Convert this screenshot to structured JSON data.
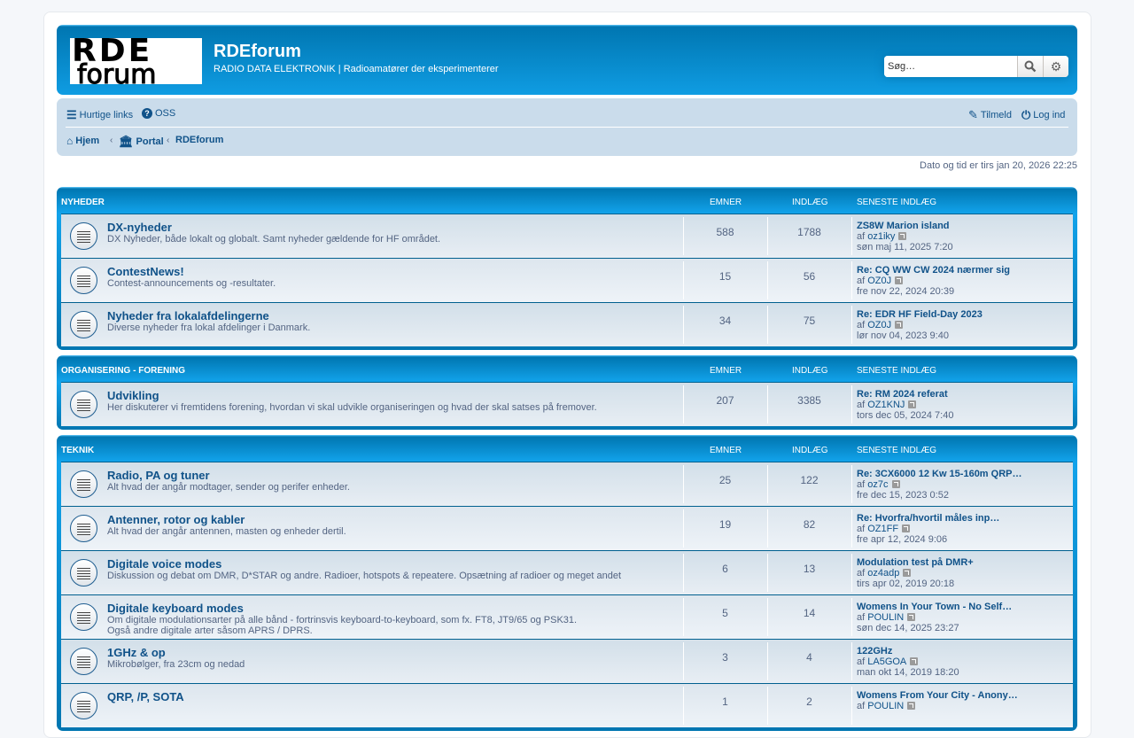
{
  "header": {
    "logo_text": "RDE forum",
    "site_title": "RDEforum",
    "site_description": "RADIO DATA ELEKTRONIK | Radioamatører der eksperimenterer",
    "search_placeholder": "Søg…"
  },
  "navbar": {
    "quick_links": "Hurtige links",
    "faq": "OSS",
    "register": "Tilmeld",
    "login": "Log ind",
    "breadcrumbs": [
      "Hjem",
      "Portal",
      "RDEforum"
    ]
  },
  "datetime": "Dato og tid er tirs jan 20, 2026 22:25",
  "columns": {
    "topics": "EMNER",
    "posts": "INDLÆG",
    "last_post": "SENESTE INDLÆG"
  },
  "by_prefix": "af",
  "categories": [
    {
      "name": "NYHEDER",
      "forums": [
        {
          "title": "DX-nyheder",
          "desc": [
            "DX Nyheder, både lokalt og globalt. Samt nyheder gældende for HF området."
          ],
          "topics": "588",
          "posts": "1788",
          "last_title": "ZS8W Marion island",
          "last_user": "oz1iky",
          "last_time": "søn maj 11, 2025 7:20"
        },
        {
          "title": "ContestNews!",
          "desc": [
            "Contest-announcements og -resultater."
          ],
          "topics": "15",
          "posts": "56",
          "last_title": "Re: CQ WW CW 2024 nærmer sig",
          "last_user": "OZ0J",
          "last_time": "fre nov 22, 2024 20:39"
        },
        {
          "title": "Nyheder fra lokalafdelingerne",
          "desc": [
            "Diverse nyheder fra lokal afdelinger i Danmark."
          ],
          "topics": "34",
          "posts": "75",
          "last_title": "Re: EDR HF Field-Day 2023",
          "last_user": "OZ0J",
          "last_time": "lør nov 04, 2023 9:40"
        }
      ]
    },
    {
      "name": "ORGANISERING - FORENING",
      "forums": [
        {
          "title": "Udvikling",
          "desc": [
            "Her diskuterer vi fremtidens forening, hvordan vi skal udvikle organiseringen og hvad der skal satses på fremover."
          ],
          "topics": "207",
          "posts": "3385",
          "last_title": "Re: RM 2024 referat",
          "last_user": "OZ1KNJ",
          "last_time": "tors dec 05, 2024 7:40"
        }
      ]
    },
    {
      "name": "TEKNIK",
      "forums": [
        {
          "title": "Radio, PA og tuner",
          "desc": [
            "Alt hvad der angår modtager, sender og perifer enheder."
          ],
          "topics": "25",
          "posts": "122",
          "last_title": "Re: 3CX6000 12 Kw 15-160m QRP…",
          "last_user": "oz7c",
          "last_time": "fre dec 15, 2023 0:52"
        },
        {
          "title": "Antenner, rotor og kabler",
          "desc": [
            "Alt hvad der angår antennen, masten og enheder dertil."
          ],
          "topics": "19",
          "posts": "82",
          "last_title": "Re: Hvorfra/hvortil måles inp…",
          "last_user": "OZ1FF",
          "last_time": "fre apr 12, 2024 9:06"
        },
        {
          "title": "Digitale voice modes",
          "desc": [
            "Diskussion og debat om DMR, D*STAR og andre. Radioer, hotspots & repeatere. Opsætning af radioer og meget andet"
          ],
          "topics": "6",
          "posts": "13",
          "last_title": "Modulation test på DMR+",
          "last_user": "oz4adp",
          "last_time": "tirs apr 02, 2019 20:18"
        },
        {
          "title": "Digitale keyboard modes",
          "desc": [
            "Om digitale modulationsarter på alle bånd - fortrinsvis keyboard-to-keyboard, som fx. FT8, JT9/65 og PSK31.",
            "Også andre digitale arter såsom APRS / DPRS."
          ],
          "topics": "5",
          "posts": "14",
          "last_title": "Womens In Your Town - No Self…",
          "last_user": "POULIN",
          "last_time": "søn dec 14, 2025 23:27"
        },
        {
          "title": "1GHz & op",
          "desc": [
            "Mikrobølger, fra 23cm og nedad"
          ],
          "topics": "3",
          "posts": "4",
          "last_title": "122GHz",
          "last_user": "LA5GOA",
          "last_time": "man okt 14, 2019 18:20"
        },
        {
          "title": "QRP, /P, SOTA",
          "desc": [
            ""
          ],
          "topics": "1",
          "posts": "2",
          "last_title": "Womens From Your City - Anony…",
          "last_user": "POULIN",
          "last_time": ""
        }
      ]
    }
  ]
}
